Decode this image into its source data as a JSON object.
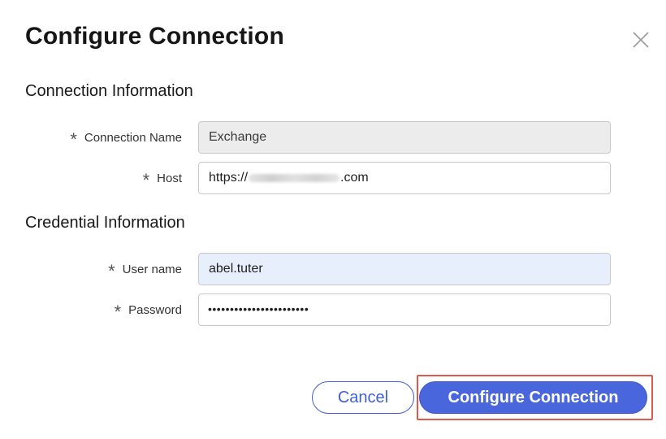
{
  "dialog": {
    "title": "Configure Connection",
    "close_icon": "close-icon"
  },
  "sections": {
    "connection": {
      "heading": "Connection Information",
      "fields": {
        "connection_name": {
          "label": "Connection Name",
          "value": "Exchange",
          "required": true,
          "readonly": true
        },
        "host": {
          "label": "Host",
          "value_prefix": "https://",
          "value_suffix": ".com",
          "required": true
        }
      }
    },
    "credential": {
      "heading": "Credential Information",
      "fields": {
        "username": {
          "label": "User name",
          "value": "abel.tuter",
          "required": true
        },
        "password": {
          "label": "Password",
          "masked_value": "•••••••••••••••••••••••",
          "required": true
        }
      }
    }
  },
  "required_marker": "*",
  "buttons": {
    "cancel": "Cancel",
    "configure": "Configure Connection"
  },
  "colors": {
    "primary": "#4a66dc",
    "highlight": "#e05a4b",
    "readonly_bg": "#ececec",
    "autofill_bg": "#e8effc"
  }
}
